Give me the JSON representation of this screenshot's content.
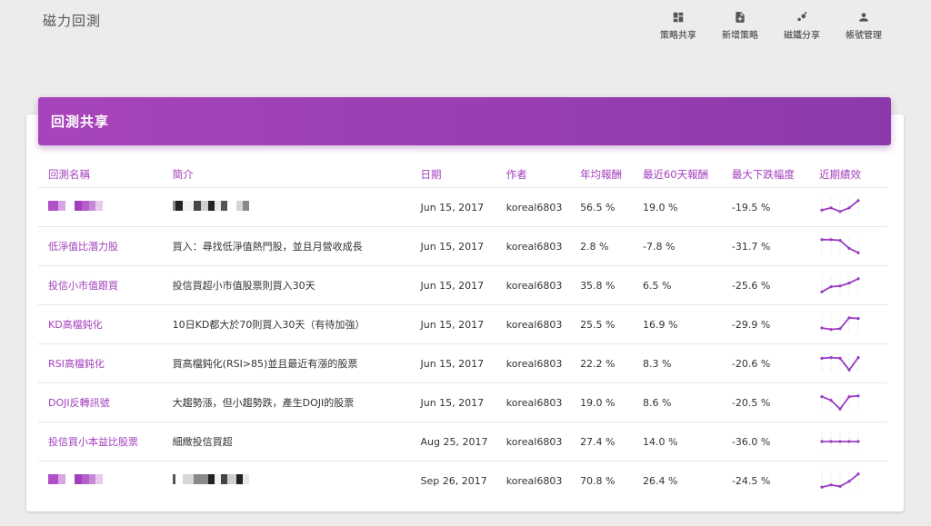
{
  "app": {
    "title": "磁力回測"
  },
  "nav": [
    {
      "label": "策略共享",
      "icon": "dashboard-icon"
    },
    {
      "label": "新增策略",
      "icon": "add-document-icon"
    },
    {
      "label": "磁鐵分享",
      "icon": "share-bubbles-icon"
    },
    {
      "label": "帳號管理",
      "icon": "person-icon"
    }
  ],
  "card": {
    "title": "回測共享"
  },
  "table": {
    "headers": {
      "name": "回測名稱",
      "desc": "簡介",
      "date": "日期",
      "author": "作者",
      "annual": "年均報酬",
      "r60": "最近60天報酬",
      "mdd": "最大下跌幅度",
      "trend": "近期績效"
    },
    "rows": [
      {
        "name": "",
        "desc": "",
        "date": "Jun 15, 2017",
        "author": "koreal6803",
        "annual": "56.5 %",
        "r60": "19.0 %",
        "mdd": "-19.5 %",
        "spark": [
          0.3,
          0.45,
          0.2,
          0.45,
          0.95
        ],
        "name_redacted": true,
        "desc_redacted": true
      },
      {
        "name": "低淨值比潛力股",
        "desc": "買入：尋找低淨值熱門股，並且月營收成長",
        "date": "Jun 15, 2017",
        "author": "koreal6803",
        "annual": "2.8 %",
        "r60": "-7.8 %",
        "mdd": "-31.7 %",
        "spark": [
          0.95,
          0.95,
          0.9,
          0.35,
          0.05
        ]
      },
      {
        "name": "投信小市值跟買",
        "desc": "投信買超小市值股票則買入30天",
        "date": "Jun 15, 2017",
        "author": "koreal6803",
        "annual": "35.8 %",
        "r60": "6.5 %",
        "mdd": "-25.6 %",
        "spark": [
          0.05,
          0.4,
          0.45,
          0.65,
          0.95
        ]
      },
      {
        "name": "KD高檔鈍化",
        "desc": "10日KD都大於70則買入30天（有待加強）",
        "date": "Jun 15, 2017",
        "author": "koreal6803",
        "annual": "25.5 %",
        "r60": "16.9 %",
        "mdd": "-29.9 %",
        "spark": [
          0.25,
          0.15,
          0.2,
          0.95,
          0.9
        ]
      },
      {
        "name": "RSI高檔鈍化",
        "desc": "買高檔鈍化(RSI>85)並且最近有漲的股票",
        "date": "Jun 15, 2017",
        "author": "koreal6803",
        "annual": "22.2 %",
        "r60": "8.3 %",
        "mdd": "-20.6 %",
        "spark": [
          0.85,
          0.9,
          0.85,
          0.05,
          0.9
        ]
      },
      {
        "name": "DOJI反轉訊號",
        "desc": "大趨勢漲，但小趨勢跌，產生DOJI的股票",
        "date": "Jun 15, 2017",
        "author": "koreal6803",
        "annual": "19.0 %",
        "r60": "8.6 %",
        "mdd": "-20.5 %",
        "spark": [
          0.9,
          0.65,
          0.05,
          0.9,
          0.95
        ]
      },
      {
        "name": "投信買小本益比股票",
        "desc": "細緻投信買超",
        "date": "Aug 25, 2017",
        "author": "koreal6803",
        "annual": "27.4 %",
        "r60": "14.0 %",
        "mdd": "-36.0 %",
        "spark": [
          0.5,
          0.5,
          0.5,
          0.5,
          0.5
        ]
      },
      {
        "name": "",
        "desc": "",
        "date": "Sep 26, 2017",
        "author": "koreal6803",
        "annual": "70.8 %",
        "r60": "26.4 %",
        "mdd": "-24.5 %",
        "spark": [
          0.05,
          0.2,
          0.1,
          0.45,
          0.95
        ],
        "name_redacted": true,
        "desc_redacted": true
      }
    ]
  },
  "colors": {
    "accent": "#a23fbc",
    "header_start": "#a844bb",
    "header_end": "#8c3aab",
    "spark": "#9b3bc2"
  }
}
